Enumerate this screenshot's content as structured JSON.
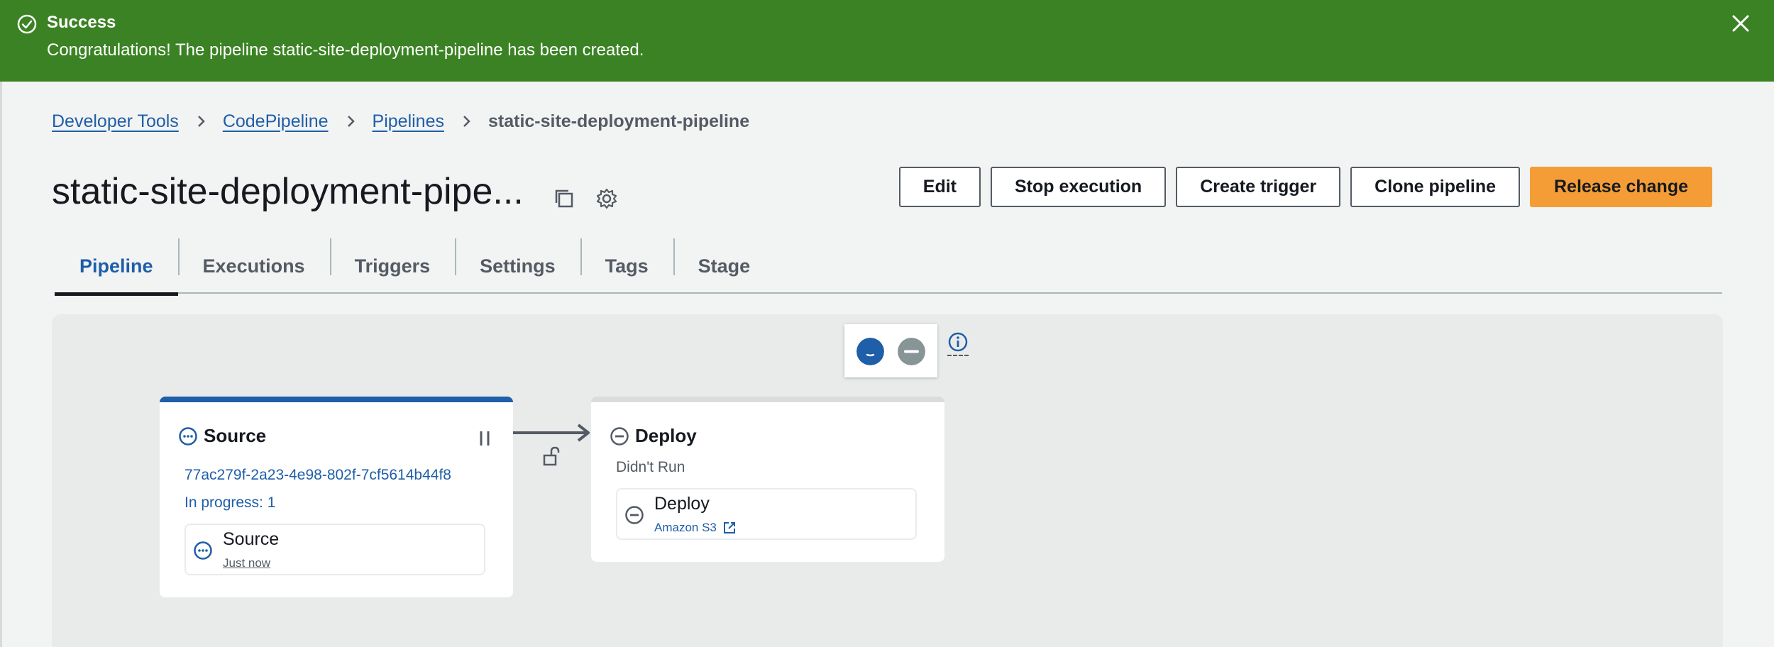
{
  "flash": {
    "title": "Success",
    "message": "Congratulations! The pipeline static-site-deployment-pipeline has been created."
  },
  "breadcrumb": [
    {
      "label": "Developer Tools"
    },
    {
      "label": "CodePipeline"
    },
    {
      "label": "Pipelines"
    },
    {
      "label": "static-site-deployment-pipeline"
    }
  ],
  "page": {
    "title": "static-site-deployment-pipe..."
  },
  "actions": {
    "edit": "Edit",
    "stop": "Stop execution",
    "trigger": "Create trigger",
    "clone": "Clone pipeline",
    "release": "Release change"
  },
  "tabs": [
    {
      "label": "Pipeline",
      "active": true
    },
    {
      "label": "Executions"
    },
    {
      "label": "Triggers"
    },
    {
      "label": "Settings"
    },
    {
      "label": "Tags"
    },
    {
      "label": "Stage"
    }
  ],
  "stages": {
    "source": {
      "name": "Source",
      "execution_id": "77ac279f-2a23-4e98-802f-7cf5614b44f8",
      "progress": "In progress: 1",
      "action": {
        "name": "Source",
        "time": "Just now"
      }
    },
    "deploy": {
      "name": "Deploy",
      "status": "Didn't Run",
      "action": {
        "name": "Deploy",
        "provider": "Amazon S3"
      }
    }
  },
  "colors": {
    "success": "#3b8224",
    "link": "#1f5ea8",
    "primary": "#f49d37",
    "neutral": "#879596"
  },
  "icons": {
    "flash": "check-circle-icon",
    "close": "close-icon",
    "copy": "copy-icon",
    "settings": "gear-icon",
    "in_progress": "in-progress-icon",
    "not_run": "minus-circle-icon",
    "pause": "pause-icon",
    "lock": "unlock-icon",
    "info": "info-icon",
    "external": "external-link-icon"
  }
}
